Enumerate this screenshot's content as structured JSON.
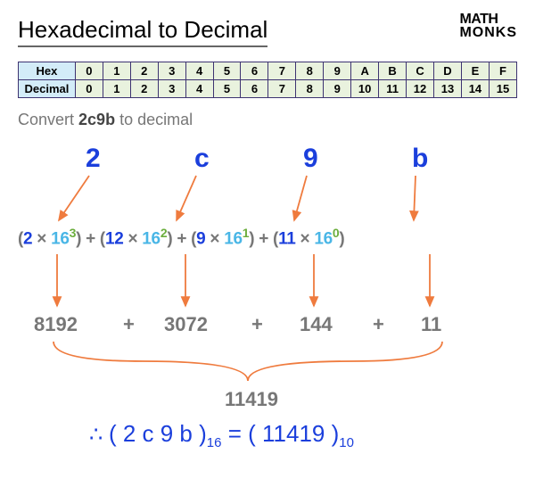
{
  "title": "Hexadecimal to Decimal",
  "logo": {
    "line1": "MATH",
    "line2": "MONKS"
  },
  "table": {
    "hex_label": "Hex",
    "dec_label": "Decimal",
    "hex": [
      "0",
      "1",
      "2",
      "3",
      "4",
      "5",
      "6",
      "7",
      "8",
      "9",
      "A",
      "B",
      "C",
      "D",
      "E",
      "F"
    ],
    "dec": [
      "0",
      "1",
      "2",
      "3",
      "4",
      "5",
      "6",
      "7",
      "8",
      "9",
      "10",
      "11",
      "12",
      "13",
      "14",
      "15"
    ]
  },
  "prompt_prefix": "Convert ",
  "prompt_value": "2c9b",
  "prompt_suffix": " to decimal",
  "digits": {
    "d0": "2",
    "d1": "c",
    "d2": "9",
    "d3": "b"
  },
  "expr": {
    "t0": "(",
    "v0": "2",
    "m0": " × ",
    "b0": "16",
    "e0": "3",
    "t0c": ")",
    "p1": " + ",
    "t1": "(",
    "v1": "12",
    "m1": " × ",
    "b1": "16",
    "e1": "2",
    "t1c": ")",
    "p2": " + ",
    "t2": "(",
    "v2": "9",
    "m2": " × ",
    "b2": "16",
    "e2": "1",
    "t2c": ")",
    "p3": " + ",
    "t3": "(",
    "v3": "11",
    "m3": " × ",
    "b3": "16",
    "e3": "0",
    "t3c": ")"
  },
  "prods": {
    "p0": "8192",
    "pl0": "+",
    "p1": "3072",
    "pl1": "+",
    "p2": "144",
    "pl2": "+",
    "p3": "11"
  },
  "sum": "11419",
  "final": {
    "therefore": "∴ ",
    "open1": "( ",
    "hex": "2 c 9 b",
    "close1": " )",
    "sub1": "16",
    "eq": "  =  ",
    "open2": "( ",
    "dec": "11419",
    "close2": " )",
    "sub2": "10"
  }
}
